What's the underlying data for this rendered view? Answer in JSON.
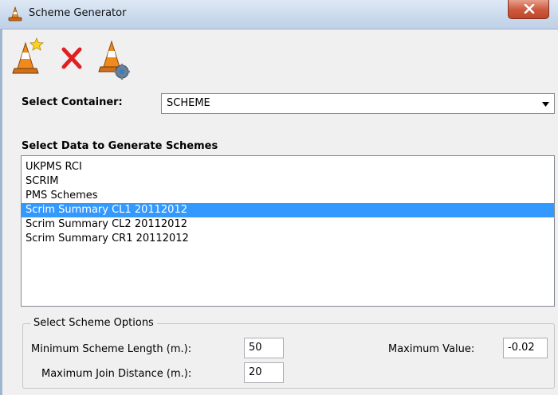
{
  "window": {
    "title": "Scheme Generator"
  },
  "toolbar": {
    "new_icon": "cone-star-icon",
    "delete_icon": "red-x-icon",
    "settings_icon": "cone-gear-icon"
  },
  "container": {
    "label": "Select Container:",
    "value": "SCHEME"
  },
  "data_list": {
    "label": "Select Data to Generate Schemes",
    "items": [
      "UKPMS RCI",
      "SCRIM",
      "PMS Schemes",
      "Scrim Summary CL1 20112012",
      "Scrim Summary CL2 20112012",
      "Scrim Summary CR1 20112012"
    ],
    "selected": "Scrim Summary CL1 20112012"
  },
  "options": {
    "legend": "Select Scheme Options",
    "min_length_label": "Minimum Scheme Length (m.):",
    "min_length_value": "50",
    "max_join_label": "Maximum Join Distance (m.):",
    "max_join_value": "20",
    "max_value_label": "Maximum Value:",
    "max_value_value": "-0.02"
  },
  "colors": {
    "selection": "#3399ff",
    "delete": "#e02020",
    "cone": "#f08a1c"
  }
}
